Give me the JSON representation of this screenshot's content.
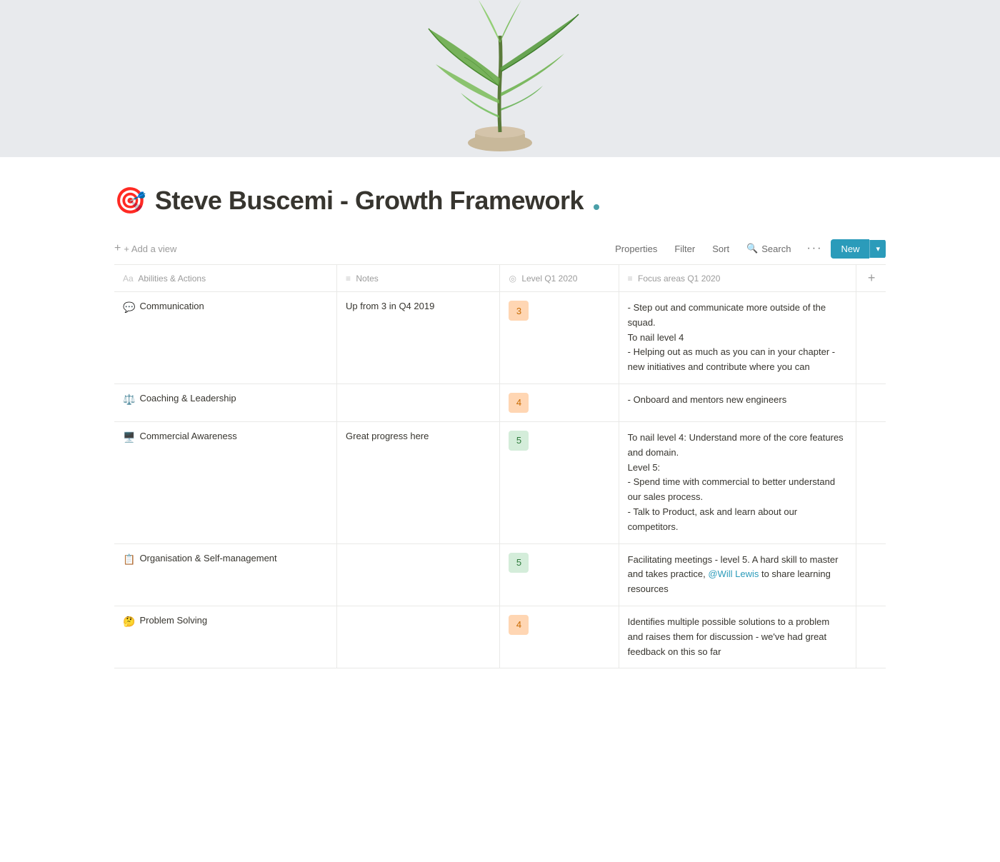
{
  "hero": {
    "alt": "Plant banner image"
  },
  "page": {
    "icon": "🎯",
    "title": "Steve Buscemi - Growth Framework",
    "status_dot": true
  },
  "toolbar": {
    "add_view_label": "+ Add a view",
    "properties_label": "Properties",
    "filter_label": "Filter",
    "sort_label": "Sort",
    "search_label": "Search",
    "more_label": "···",
    "new_label": "New",
    "dropdown_label": "▾"
  },
  "table": {
    "columns": [
      {
        "id": "abilities",
        "icon": "Aa",
        "label": "Abilities & Actions"
      },
      {
        "id": "notes",
        "icon": "≡",
        "label": "Notes"
      },
      {
        "id": "level",
        "icon": "◎",
        "label": "Level Q1 2020"
      },
      {
        "id": "focus",
        "icon": "≡",
        "label": "Focus areas Q1 2020"
      }
    ],
    "rows": [
      {
        "ability": "Communication",
        "ability_emoji": "💬",
        "notes": "Up from 3 in Q4 2019",
        "level": "3",
        "level_class": "level-3",
        "focus": "- Step out and communicate more outside of the squad.\nTo nail level 4\n- Helping out as much as you can in your chapter - new initiatives and contribute where you can"
      },
      {
        "ability": "Coaching & Leadership",
        "ability_emoji": "⚖️",
        "notes": "",
        "level": "4",
        "level_class": "level-4",
        "focus": "- Onboard and mentors new engineers"
      },
      {
        "ability": "Commercial Awareness",
        "ability_emoji": "🖥️",
        "notes": "Great progress here",
        "level": "5",
        "level_class": "level-5",
        "focus": "To nail level 4: Understand more of the core features and domain.\nLevel 5:\n- Spend time with commercial to better understand our sales process.\n- Talk to Product, ask and learn about our competitors."
      },
      {
        "ability": "Organisation & Self-management",
        "ability_emoji": "📋",
        "notes": "",
        "level": "5",
        "level_class": "level-5",
        "focus": "Facilitating meetings - level 5. A hard skill to master and takes practice, @Will Lewis to share learning resources"
      },
      {
        "ability": "Problem Solving",
        "ability_emoji": "🤔",
        "notes": "",
        "level": "4",
        "level_class": "level-4",
        "focus": "Identifies multiple possible solutions to a problem and raises them for discussion - we've had great feedback on this so far"
      }
    ]
  }
}
